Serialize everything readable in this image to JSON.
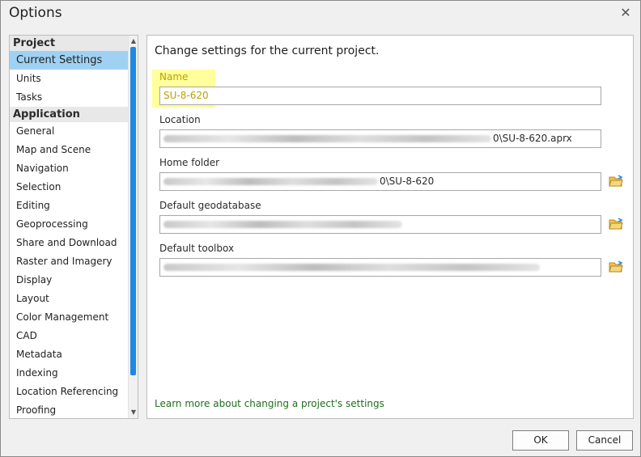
{
  "window": {
    "title": "Options"
  },
  "nav": {
    "groups": [
      {
        "header": "Project",
        "items": [
          "Current Settings",
          "Units",
          "Tasks"
        ]
      },
      {
        "header": "Application",
        "items": [
          "General",
          "Map and Scene",
          "Navigation",
          "Selection",
          "Editing",
          "Geoprocessing",
          "Share and Download",
          "Raster and Imagery",
          "Display",
          "Layout",
          "Color Management",
          "CAD",
          "Metadata",
          "Indexing",
          "Location Referencing",
          "Proofing"
        ]
      }
    ],
    "selected": "Current Settings"
  },
  "content": {
    "heading": "Change settings for the current project.",
    "name_label": "Name",
    "name_value": "SU-8-620",
    "location_label": "Location",
    "location_suffix": "0\\SU-8-620.aprx",
    "home_label": "Home folder",
    "home_suffix": "0\\SU-8-620",
    "gdb_label": "Default geodatabase",
    "toolbox_label": "Default toolbox",
    "learn_link": "Learn more about changing a project's settings"
  },
  "buttons": {
    "ok": "OK",
    "cancel": "Cancel"
  },
  "colors": {
    "selection": "#9fd1f3",
    "highlight": "#ffff8a",
    "scroll_thumb": "#1e88e5",
    "link": "#1f6f1f"
  },
  "icons": {
    "close": "close-icon",
    "folder": "folder-open-icon"
  }
}
